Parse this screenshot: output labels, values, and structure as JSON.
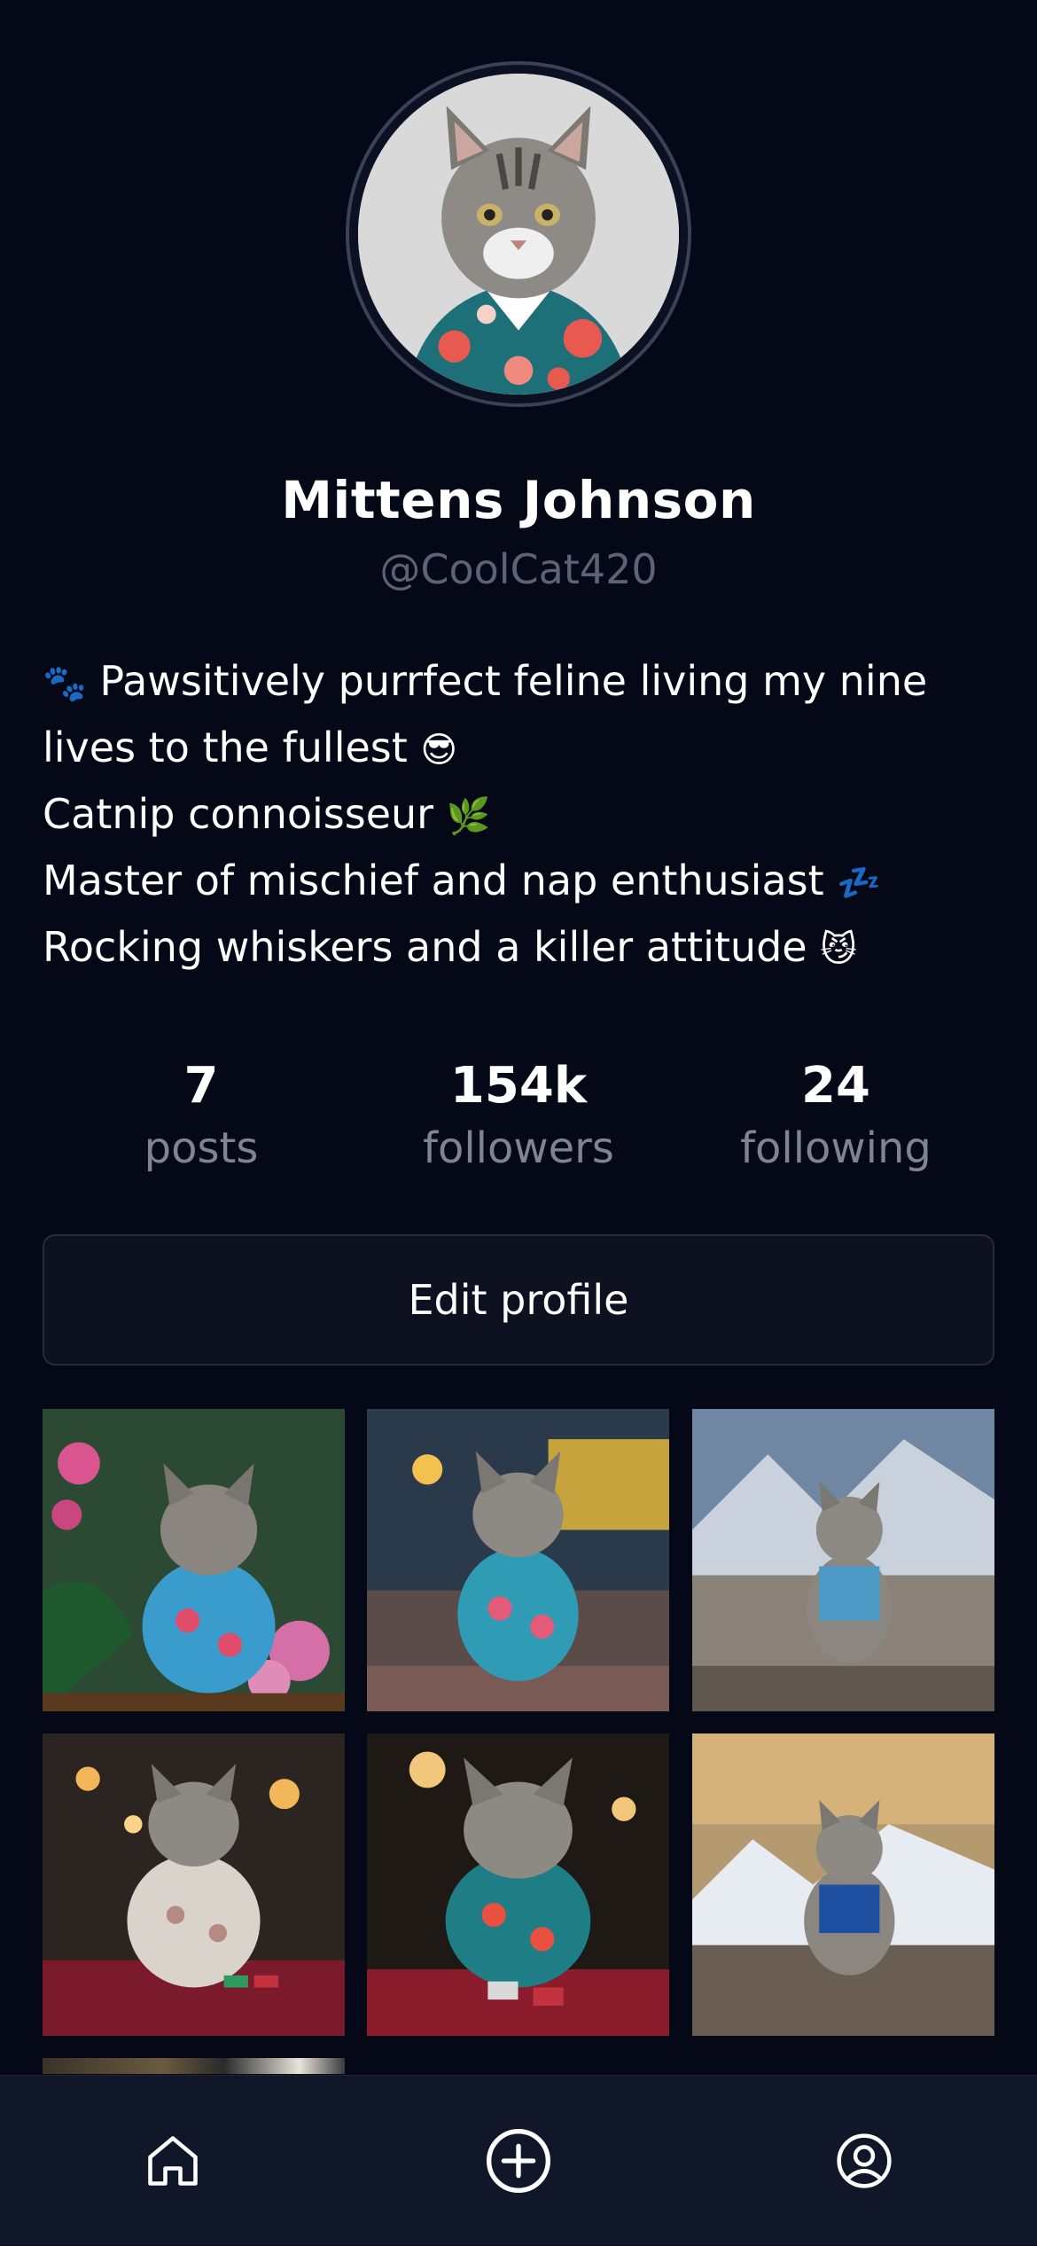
{
  "profile": {
    "name": "Mittens Johnson",
    "handle": "@CoolCat420",
    "avatar_alt": "cat-avatar"
  },
  "bio": {
    "lines": [
      {
        "emoji_prefix": "🐾",
        "text": " Pawsitively purrfect feline living my nine",
        "emoji_suffix": ""
      },
      {
        "emoji_prefix": "",
        "text": "lives to the fullest ",
        "emoji_suffix": "😎"
      },
      {
        "emoji_prefix": "",
        "text": "Catnip connoisseur ",
        "emoji_suffix": "🌿"
      },
      {
        "emoji_prefix": "",
        "text": "Master of mischief and nap enthusiast ",
        "emoji_suffix": "💤"
      },
      {
        "emoji_prefix": "",
        "text": "Rocking whiskers and a killer attitude ",
        "emoji_suffix": "😼"
      }
    ]
  },
  "stats": {
    "posts": {
      "value": "7",
      "label": "posts"
    },
    "followers": {
      "value": "154k",
      "label": "followers"
    },
    "following": {
      "value": "24",
      "label": "following"
    }
  },
  "actions": {
    "edit_profile_label": "Edit profile"
  },
  "posts": [
    {
      "name": "post-cat-flowers"
    },
    {
      "name": "post-cat-casino-street"
    },
    {
      "name": "post-cat-mountains"
    },
    {
      "name": "post-cat-poker-table"
    },
    {
      "name": "post-cat-poker-chips"
    },
    {
      "name": "post-cat-mountain-sunset"
    },
    {
      "name": "post-partial"
    }
  ],
  "nav": {
    "icons": [
      "home-icon",
      "add-post-icon",
      "profile-icon"
    ]
  },
  "colors": {
    "background": "#050816",
    "nav_background": "#0f1729",
    "muted_text": "#7e8494",
    "handle_text": "#5c6375",
    "button_border": "#262c3c"
  }
}
